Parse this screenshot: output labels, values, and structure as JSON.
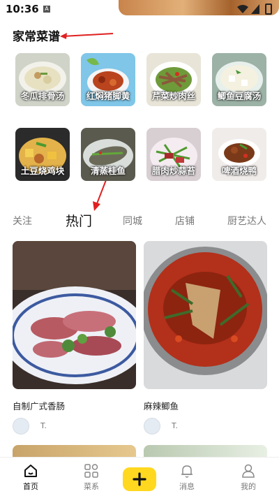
{
  "status_bar": {
    "time": "10:36",
    "a_icon": "A"
  },
  "section": {
    "title": "家常菜谱"
  },
  "recipes": [
    {
      "label": "冬瓜排骨汤",
      "icon": "soup-photo"
    },
    {
      "label": "红焖猪脚黄",
      "icon": "braised-pork-photo"
    },
    {
      "label": "芹菜炒肉丝",
      "icon": "celery-pork-photo"
    },
    {
      "label": "鲫鱼豆腐汤",
      "icon": "fish-tofu-soup-photo"
    },
    {
      "label": "土豆烧鸡块",
      "icon": "potato-chicken-photo"
    },
    {
      "label": "清蒸桂鱼",
      "icon": "steamed-fish-photo"
    },
    {
      "label": "腊肉炒蒜苔",
      "icon": "bacon-garlic-photo"
    },
    {
      "label": "啤酒烧鸭",
      "icon": "beer-duck-photo"
    }
  ],
  "tabs": [
    {
      "label": "关注"
    },
    {
      "label": "热门"
    },
    {
      "label": "同城"
    },
    {
      "label": "店铺"
    },
    {
      "label": "厨艺达人"
    }
  ],
  "feed": [
    {
      "title": "自制广式香肠",
      "author": "T."
    },
    {
      "title": "麻辣鲫鱼",
      "author": "T."
    }
  ],
  "nav": {
    "home": "首页",
    "categories": "菜系",
    "messages": "消息",
    "profile": "我的"
  },
  "colors": {
    "accent": "#ffd81f",
    "annotation_arrow": "#e02020"
  }
}
